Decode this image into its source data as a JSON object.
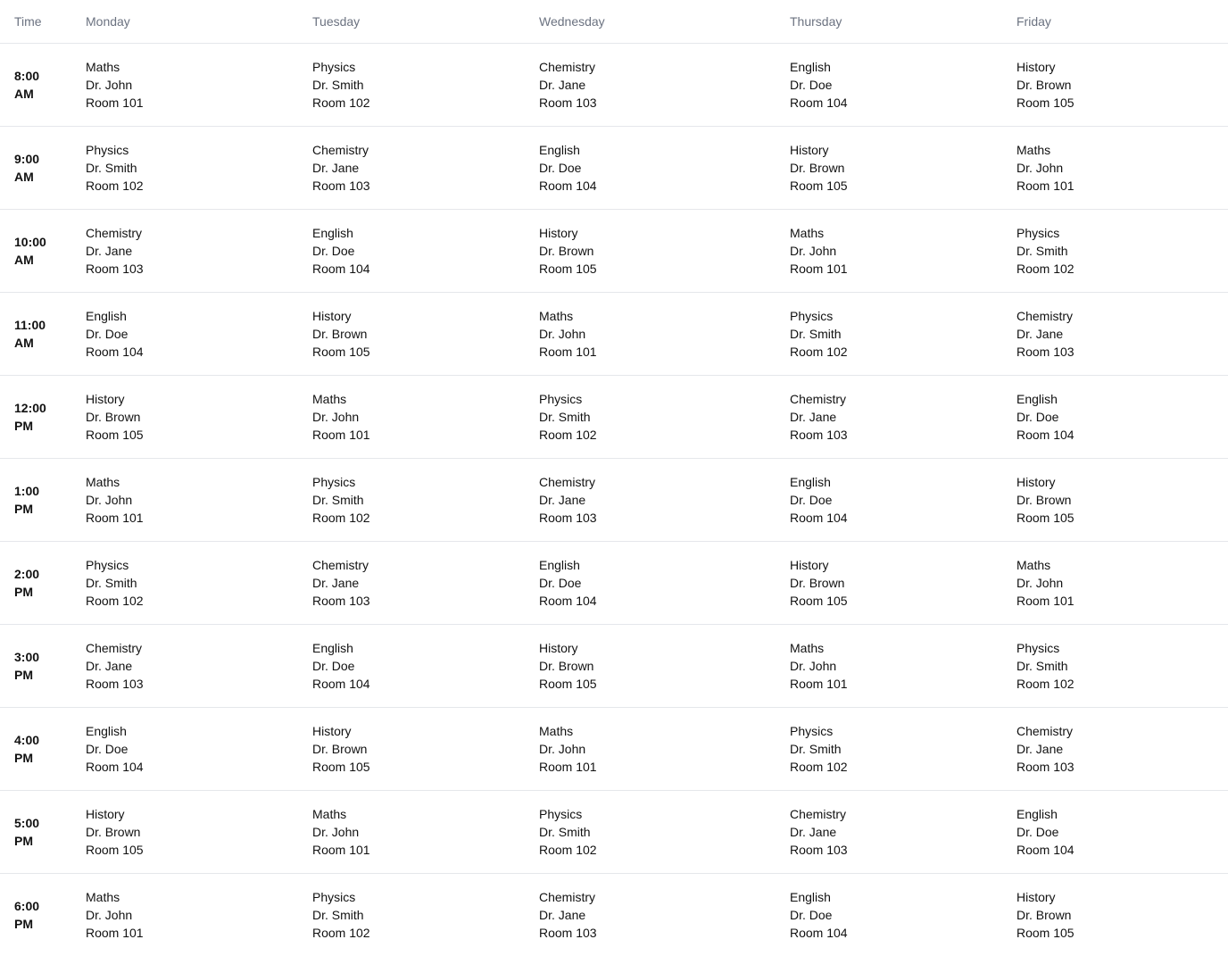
{
  "header": {
    "time": "Time",
    "days": [
      "Monday",
      "Tuesday",
      "Wednesday",
      "Thursday",
      "Friday"
    ]
  },
  "rows": [
    {
      "time": [
        "8:00",
        "AM"
      ],
      "slots": [
        {
          "subject": "Maths",
          "teacher": "Dr. John",
          "room": "Room 101"
        },
        {
          "subject": "Physics",
          "teacher": "Dr. Smith",
          "room": "Room 102"
        },
        {
          "subject": "Chemistry",
          "teacher": "Dr. Jane",
          "room": "Room 103"
        },
        {
          "subject": "English",
          "teacher": "Dr. Doe",
          "room": "Room 104"
        },
        {
          "subject": "History",
          "teacher": "Dr. Brown",
          "room": "Room 105"
        }
      ]
    },
    {
      "time": [
        "9:00",
        "AM"
      ],
      "slots": [
        {
          "subject": "Physics",
          "teacher": "Dr. Smith",
          "room": "Room 102"
        },
        {
          "subject": "Chemistry",
          "teacher": "Dr. Jane",
          "room": "Room 103"
        },
        {
          "subject": "English",
          "teacher": "Dr. Doe",
          "room": "Room 104"
        },
        {
          "subject": "History",
          "teacher": "Dr. Brown",
          "room": "Room 105"
        },
        {
          "subject": "Maths",
          "teacher": "Dr. John",
          "room": "Room 101"
        }
      ]
    },
    {
      "time": [
        "10:00",
        "AM"
      ],
      "slots": [
        {
          "subject": "Chemistry",
          "teacher": "Dr. Jane",
          "room": "Room 103"
        },
        {
          "subject": "English",
          "teacher": "Dr. Doe",
          "room": "Room 104"
        },
        {
          "subject": "History",
          "teacher": "Dr. Brown",
          "room": "Room 105"
        },
        {
          "subject": "Maths",
          "teacher": "Dr. John",
          "room": "Room 101"
        },
        {
          "subject": "Physics",
          "teacher": "Dr. Smith",
          "room": "Room 102"
        }
      ]
    },
    {
      "time": [
        "11:00",
        "AM"
      ],
      "slots": [
        {
          "subject": "English",
          "teacher": "Dr. Doe",
          "room": "Room 104"
        },
        {
          "subject": "History",
          "teacher": "Dr. Brown",
          "room": "Room 105"
        },
        {
          "subject": "Maths",
          "teacher": "Dr. John",
          "room": "Room 101"
        },
        {
          "subject": "Physics",
          "teacher": "Dr. Smith",
          "room": "Room 102"
        },
        {
          "subject": "Chemistry",
          "teacher": "Dr. Jane",
          "room": "Room 103"
        }
      ]
    },
    {
      "time": [
        "12:00",
        "PM"
      ],
      "slots": [
        {
          "subject": "History",
          "teacher": "Dr. Brown",
          "room": "Room 105"
        },
        {
          "subject": "Maths",
          "teacher": "Dr. John",
          "room": "Room 101"
        },
        {
          "subject": "Physics",
          "teacher": "Dr. Smith",
          "room": "Room 102"
        },
        {
          "subject": "Chemistry",
          "teacher": "Dr. Jane",
          "room": "Room 103"
        },
        {
          "subject": "English",
          "teacher": "Dr. Doe",
          "room": "Room 104"
        }
      ]
    },
    {
      "time": [
        "1:00",
        "PM"
      ],
      "slots": [
        {
          "subject": "Maths",
          "teacher": "Dr. John",
          "room": "Room 101"
        },
        {
          "subject": "Physics",
          "teacher": "Dr. Smith",
          "room": "Room 102"
        },
        {
          "subject": "Chemistry",
          "teacher": "Dr. Jane",
          "room": "Room 103"
        },
        {
          "subject": "English",
          "teacher": "Dr. Doe",
          "room": "Room 104"
        },
        {
          "subject": "History",
          "teacher": "Dr. Brown",
          "room": "Room 105"
        }
      ]
    },
    {
      "time": [
        "2:00",
        "PM"
      ],
      "slots": [
        {
          "subject": "Physics",
          "teacher": "Dr. Smith",
          "room": "Room 102"
        },
        {
          "subject": "Chemistry",
          "teacher": "Dr. Jane",
          "room": "Room 103"
        },
        {
          "subject": "English",
          "teacher": "Dr. Doe",
          "room": "Room 104"
        },
        {
          "subject": "History",
          "teacher": "Dr. Brown",
          "room": "Room 105"
        },
        {
          "subject": "Maths",
          "teacher": "Dr. John",
          "room": "Room 101"
        }
      ]
    },
    {
      "time": [
        "3:00",
        "PM"
      ],
      "slots": [
        {
          "subject": "Chemistry",
          "teacher": "Dr. Jane",
          "room": "Room 103"
        },
        {
          "subject": "English",
          "teacher": "Dr. Doe",
          "room": "Room 104"
        },
        {
          "subject": "History",
          "teacher": "Dr. Brown",
          "room": "Room 105"
        },
        {
          "subject": "Maths",
          "teacher": "Dr. John",
          "room": "Room 101"
        },
        {
          "subject": "Physics",
          "teacher": "Dr. Smith",
          "room": "Room 102"
        }
      ]
    },
    {
      "time": [
        "4:00",
        "PM"
      ],
      "slots": [
        {
          "subject": "English",
          "teacher": "Dr. Doe",
          "room": "Room 104"
        },
        {
          "subject": "History",
          "teacher": "Dr. Brown",
          "room": "Room 105"
        },
        {
          "subject": "Maths",
          "teacher": "Dr. John",
          "room": "Room 101"
        },
        {
          "subject": "Physics",
          "teacher": "Dr. Smith",
          "room": "Room 102"
        },
        {
          "subject": "Chemistry",
          "teacher": "Dr. Jane",
          "room": "Room 103"
        }
      ]
    },
    {
      "time": [
        "5:00",
        "PM"
      ],
      "slots": [
        {
          "subject": "History",
          "teacher": "Dr. Brown",
          "room": "Room 105"
        },
        {
          "subject": "Maths",
          "teacher": "Dr. John",
          "room": "Room 101"
        },
        {
          "subject": "Physics",
          "teacher": "Dr. Smith",
          "room": "Room 102"
        },
        {
          "subject": "Chemistry",
          "teacher": "Dr. Jane",
          "room": "Room 103"
        },
        {
          "subject": "English",
          "teacher": "Dr. Doe",
          "room": "Room 104"
        }
      ]
    },
    {
      "time": [
        "6:00",
        "PM"
      ],
      "slots": [
        {
          "subject": "Maths",
          "teacher": "Dr. John",
          "room": "Room 101"
        },
        {
          "subject": "Physics",
          "teacher": "Dr. Smith",
          "room": "Room 102"
        },
        {
          "subject": "Chemistry",
          "teacher": "Dr. Jane",
          "room": "Room 103"
        },
        {
          "subject": "English",
          "teacher": "Dr. Doe",
          "room": "Room 104"
        },
        {
          "subject": "History",
          "teacher": "Dr. Brown",
          "room": "Room 105"
        }
      ]
    }
  ]
}
